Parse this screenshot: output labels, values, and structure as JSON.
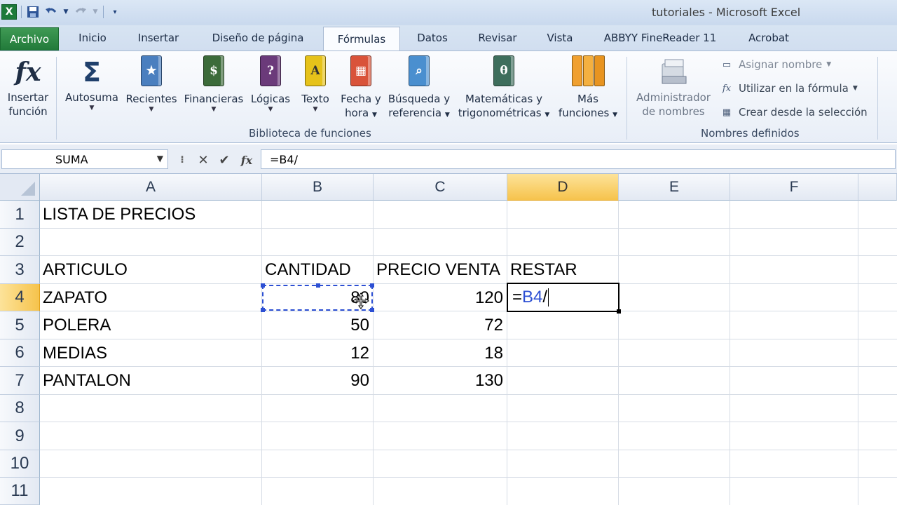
{
  "window": {
    "title": "tutoriales  -  Microsoft Excel",
    "app_icon": "excel-logo",
    "quick_access": [
      "save-icon",
      "undo-icon",
      "redo-icon",
      "customize-icon"
    ]
  },
  "tabs": [
    {
      "label": "Archivo",
      "state": "file"
    },
    {
      "label": "Inicio"
    },
    {
      "label": "Insertar"
    },
    {
      "label": "Diseño de página"
    },
    {
      "label": "Fórmulas",
      "state": "active"
    },
    {
      "label": "Datos"
    },
    {
      "label": "Revisar"
    },
    {
      "label": "Vista"
    },
    {
      "label": "ABBYY FineReader 11"
    },
    {
      "label": "Acrobat"
    }
  ],
  "ribbon": {
    "insert_function": {
      "line1": "Insertar",
      "line2": "función"
    },
    "library": {
      "group_label": "Biblioteca de funciones",
      "buttons": [
        {
          "line1": "Autosuma",
          "icon": "sigma-icon",
          "color": "#1f3f6b"
        },
        {
          "line1": "Recientes",
          "icon": "star-book-icon",
          "color": "#4a7fbf"
        },
        {
          "line1": "Financieras",
          "icon": "money-book-icon",
          "color": "#3c6b3a"
        },
        {
          "line1": "Lógicas",
          "icon": "question-book-icon",
          "color": "#6b3a7a"
        },
        {
          "line1": "Texto",
          "icon": "text-book-icon",
          "color": "#e6c21a"
        },
        {
          "line1": "Fecha y",
          "line2": "hora",
          "icon": "calendar-book-icon",
          "color": "#d9533a"
        },
        {
          "line1": "Búsqueda y",
          "line2": "referencia",
          "icon": "search-book-icon",
          "color": "#4a8fcf"
        },
        {
          "line1": "Matemáticas y",
          "line2": "trigonométricas",
          "icon": "theta-book-icon",
          "color": "#3e6e5c"
        },
        {
          "line1": "Más",
          "line2": "funciones",
          "icon": "more-books-icon",
          "color": "#f0a030"
        }
      ]
    },
    "names": {
      "group_label": "Nombres definidos",
      "manager": {
        "line1": "Administrador",
        "line2": "de nombres"
      },
      "commands": [
        {
          "label": "Asignar nombre",
          "icon": "tag-icon",
          "enabled": false
        },
        {
          "label": "Utilizar en la fórmula",
          "icon": "fx-small-icon",
          "enabled": true
        },
        {
          "label": "Crear desde la selección",
          "icon": "grid-create-icon",
          "enabled": true
        }
      ]
    },
    "fx_glyph": "fx",
    "sigma_glyph": "Σ",
    "theta_glyph": "θ",
    "question_glyph": "?",
    "text_glyph": "A"
  },
  "formula_bar": {
    "name_box": "SUMA",
    "cancel": "✕",
    "enter": "✔",
    "fx": "fx",
    "formula": "=B4/"
  },
  "sheet": {
    "columns": [
      "A",
      "B",
      "C",
      "D",
      "E",
      "F"
    ],
    "selected_column": "D",
    "rows": [
      "1",
      "2",
      "3",
      "4",
      "5",
      "6",
      "7",
      "8",
      "9",
      "10",
      "11"
    ],
    "selected_row": "4",
    "cells": {
      "A1": "LISTA DE PRECIOS",
      "A3": "ARTICULO",
      "B3": "CANTIDAD",
      "C3": "PRECIO VENTA",
      "D3": "RESTAR",
      "A4": "ZAPATO",
      "B4": "80",
      "C4": "120",
      "A5": "POLERA",
      "B5": "50",
      "C5": "72",
      "A6": "MEDIAS",
      "B6": "12",
      "C6": "18",
      "A7": "PANTALON",
      "B7": "90",
      "C7": "130"
    },
    "editing_cell": {
      "prefix": "=",
      "ref": "B4",
      "suffix": "/"
    },
    "colors": {
      "reference": "#2c4fd3",
      "selected_header": "#f6c34c"
    }
  }
}
